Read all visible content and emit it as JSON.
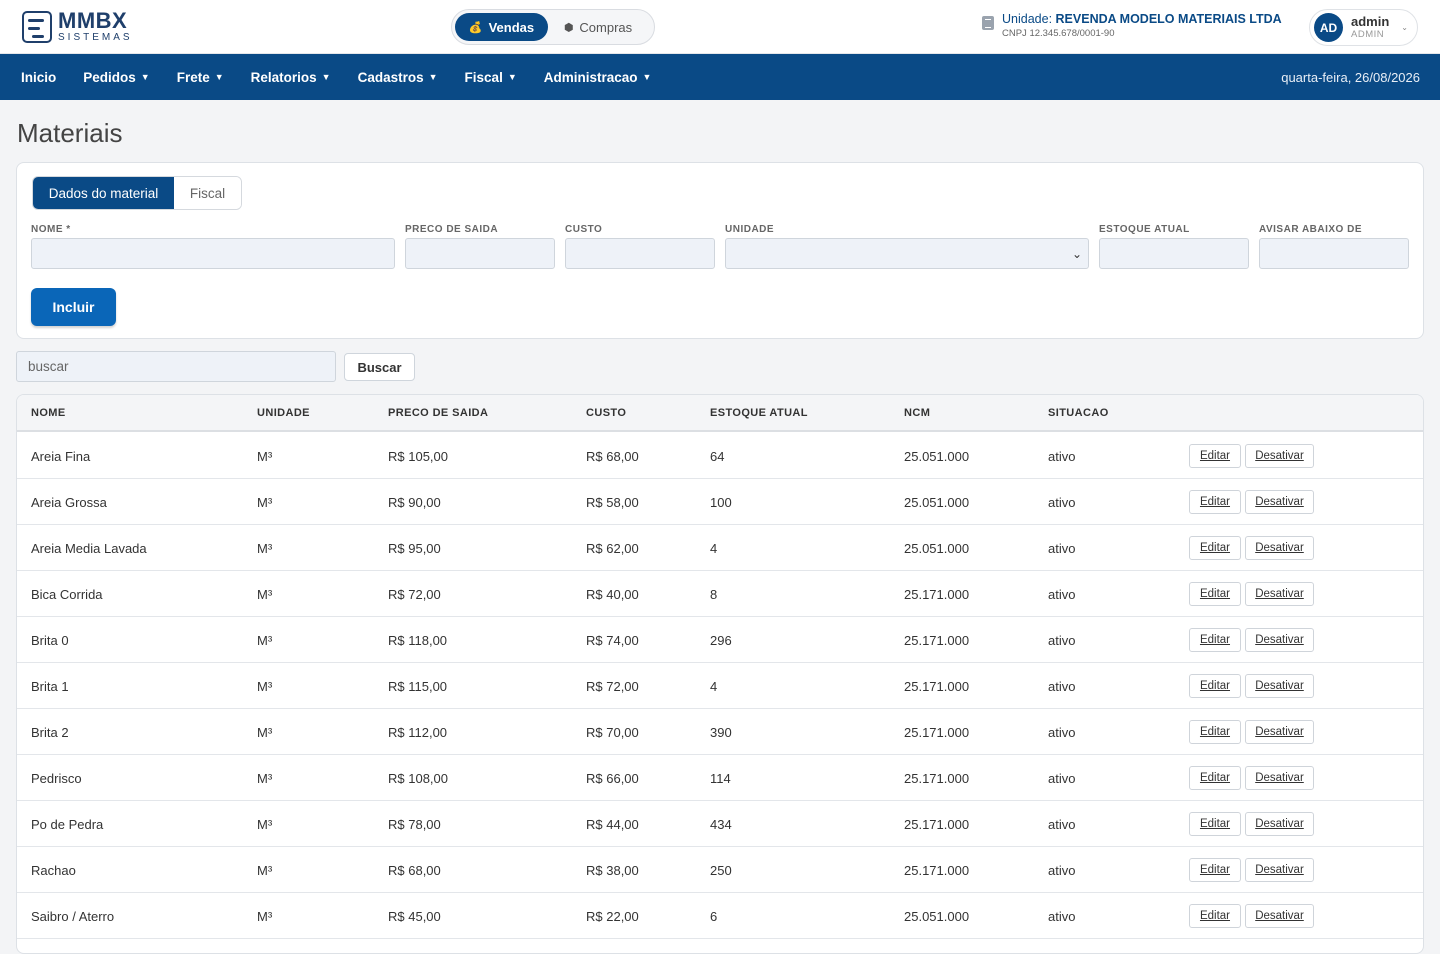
{
  "brand": {
    "title": "MMBX",
    "subtitle": "SISTEMAS"
  },
  "mode_toggle": {
    "items": [
      {
        "label": "Vendas",
        "active": true,
        "icon": "money-bag-icon"
      },
      {
        "label": "Compras",
        "active": false,
        "icon": "box-icon"
      }
    ]
  },
  "unit": {
    "prefix": "Unidade:",
    "name": "REVENDA MODELO MATERIAIS LTDA",
    "cnpj": "CNPJ 12.345.678/0001-90"
  },
  "user": {
    "initials": "AD",
    "name": "admin",
    "role": "ADMIN"
  },
  "nav": {
    "items": [
      {
        "label": "Inicio",
        "has_caret": false
      },
      {
        "label": "Pedidos",
        "has_caret": true
      },
      {
        "label": "Frete",
        "has_caret": true
      },
      {
        "label": "Relatorios",
        "has_caret": true
      },
      {
        "label": "Cadastros",
        "has_caret": true
      },
      {
        "label": "Fiscal",
        "has_caret": true
      },
      {
        "label": "Administracao",
        "has_caret": true
      }
    ],
    "date": "quarta-feira, 26/08/2026"
  },
  "page": {
    "title": "Materiais"
  },
  "form": {
    "tabs": [
      {
        "label": "Dados do material",
        "active": true
      },
      {
        "label": "Fiscal",
        "active": false
      }
    ],
    "fields": {
      "nome": {
        "label": "NOME *",
        "value": ""
      },
      "preco_saida": {
        "label": "PRECO DE SAIDA",
        "value": ""
      },
      "custo": {
        "label": "CUSTO",
        "value": ""
      },
      "unidade": {
        "label": "UNIDADE",
        "value": ""
      },
      "estoque_atual": {
        "label": "ESTOQUE ATUAL",
        "value": ""
      },
      "avisar_abaixo": {
        "label": "AVISAR ABAIXO DE",
        "value": ""
      }
    },
    "submit_label": "Incluir"
  },
  "search": {
    "placeholder": "buscar",
    "button_label": "Buscar"
  },
  "table": {
    "headers": [
      "NOME",
      "UNIDADE",
      "PRECO DE SAIDA",
      "CUSTO",
      "ESTOQUE ATUAL",
      "NCM",
      "SITUACAO"
    ],
    "edit_label": "Editar",
    "deactivate_label": "Desativar",
    "rows": [
      {
        "nome": "Areia Fina",
        "unidade": "M³",
        "preco": "R$ 105,00",
        "custo": "R$ 68,00",
        "estoque": "64",
        "ncm": "25.051.000",
        "situacao": "ativo"
      },
      {
        "nome": "Areia Grossa",
        "unidade": "M³",
        "preco": "R$ 90,00",
        "custo": "R$ 58,00",
        "estoque": "100",
        "ncm": "25.051.000",
        "situacao": "ativo"
      },
      {
        "nome": "Areia Media Lavada",
        "unidade": "M³",
        "preco": "R$ 95,00",
        "custo": "R$ 62,00",
        "estoque": "4",
        "ncm": "25.051.000",
        "situacao": "ativo"
      },
      {
        "nome": "Bica Corrida",
        "unidade": "M³",
        "preco": "R$ 72,00",
        "custo": "R$ 40,00",
        "estoque": "8",
        "ncm": "25.171.000",
        "situacao": "ativo"
      },
      {
        "nome": "Brita 0",
        "unidade": "M³",
        "preco": "R$ 118,00",
        "custo": "R$ 74,00",
        "estoque": "296",
        "ncm": "25.171.000",
        "situacao": "ativo"
      },
      {
        "nome": "Brita 1",
        "unidade": "M³",
        "preco": "R$ 115,00",
        "custo": "R$ 72,00",
        "estoque": "4",
        "ncm": "25.171.000",
        "situacao": "ativo"
      },
      {
        "nome": "Brita 2",
        "unidade": "M³",
        "preco": "R$ 112,00",
        "custo": "R$ 70,00",
        "estoque": "390",
        "ncm": "25.171.000",
        "situacao": "ativo"
      },
      {
        "nome": "Pedrisco",
        "unidade": "M³",
        "preco": "R$ 108,00",
        "custo": "R$ 66,00",
        "estoque": "114",
        "ncm": "25.171.000",
        "situacao": "ativo"
      },
      {
        "nome": "Po de Pedra",
        "unidade": "M³",
        "preco": "R$ 78,00",
        "custo": "R$ 44,00",
        "estoque": "434",
        "ncm": "25.171.000",
        "situacao": "ativo"
      },
      {
        "nome": "Rachao",
        "unidade": "M³",
        "preco": "R$ 68,00",
        "custo": "R$ 38,00",
        "estoque": "250",
        "ncm": "25.171.000",
        "situacao": "ativo"
      },
      {
        "nome": "Saibro / Aterro",
        "unidade": "M³",
        "preco": "R$ 45,00",
        "custo": "R$ 22,00",
        "estoque": "6",
        "ncm": "25.051.000",
        "situacao": "ativo"
      }
    ]
  },
  "colors": {
    "primary": "#0a4a86",
    "button": "#0a66b8",
    "background": "#f3f4f6"
  }
}
